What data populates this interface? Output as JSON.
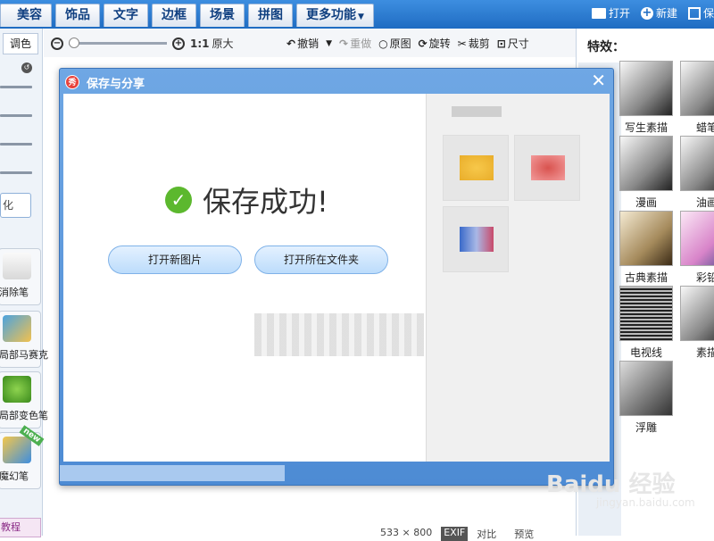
{
  "top_tabs": [
    {
      "label": "美容"
    },
    {
      "label": "饰品"
    },
    {
      "label": "文字"
    },
    {
      "label": "边框"
    },
    {
      "label": "场景"
    },
    {
      "label": "拼图"
    },
    {
      "label": "更多功能"
    }
  ],
  "top_actions": {
    "open": "打开",
    "new": "新建",
    "save": "保"
  },
  "left_panel": {
    "tab_label": "调色",
    "button_label": "化",
    "tools": [
      {
        "label": "消除笔",
        "icon": "eraser-icon"
      },
      {
        "label": "局部马赛克",
        "icon": "mosaic-icon"
      },
      {
        "label": "局部变色笔",
        "icon": "color-brush-icon"
      },
      {
        "label": "魔幻笔",
        "icon": "magic-pen-icon",
        "badge": "new"
      }
    ],
    "bottom_label": "教程"
  },
  "toolbar": {
    "zoom_ratio": "1:1",
    "zoom_label": "原大",
    "undo": "撤销",
    "redo": "重做",
    "original": "原图",
    "rotate": "旋转",
    "crop": "裁剪",
    "size": "尺寸"
  },
  "right_panel": {
    "title": "特效：",
    "effects": [
      {
        "label": "写生素描"
      },
      {
        "label": "蜡笔"
      },
      {
        "label": "漫画"
      },
      {
        "label": "油画"
      },
      {
        "label": "古典素描"
      },
      {
        "label": "彩铅"
      },
      {
        "label": "电视线"
      },
      {
        "label": "素描"
      },
      {
        "label": "浮雕"
      }
    ]
  },
  "status_bar": {
    "dimensions": "533 × 800",
    "exif": "EXIF",
    "compare": "对比",
    "preview": "预览"
  },
  "dialog": {
    "title": "保存与分享",
    "success_text": "保存成功!",
    "open_new_image": "打开新图片",
    "open_folder": "打开所在文件夹"
  },
  "watermark": {
    "brand": "Baidu 经验",
    "url": "jingyan.baidu.com"
  },
  "colors": {
    "accent": "#1f6cc2",
    "success": "#5cb82e"
  }
}
